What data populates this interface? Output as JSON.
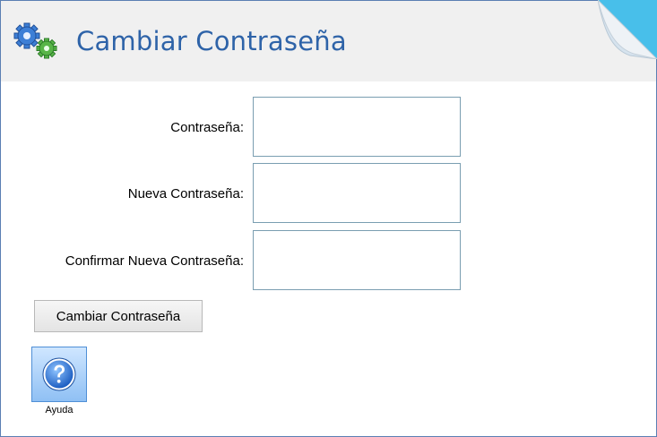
{
  "header": {
    "title": "Cambiar Contraseña",
    "icon": "gears-icon"
  },
  "form": {
    "fields": [
      {
        "label": "Contraseña:",
        "value": ""
      },
      {
        "label": "Nueva Contraseña:",
        "value": ""
      },
      {
        "label": "Confirmar Nueva Contraseña:",
        "value": ""
      }
    ],
    "submit_label": "Cambiar Contraseña"
  },
  "help": {
    "label": "Ayuda",
    "icon": "question-icon"
  },
  "colors": {
    "title": "#2e63a8",
    "header_bg": "#f0f0f0",
    "field_border": "#7a9eb1",
    "help_button": "#8fc0f4"
  }
}
